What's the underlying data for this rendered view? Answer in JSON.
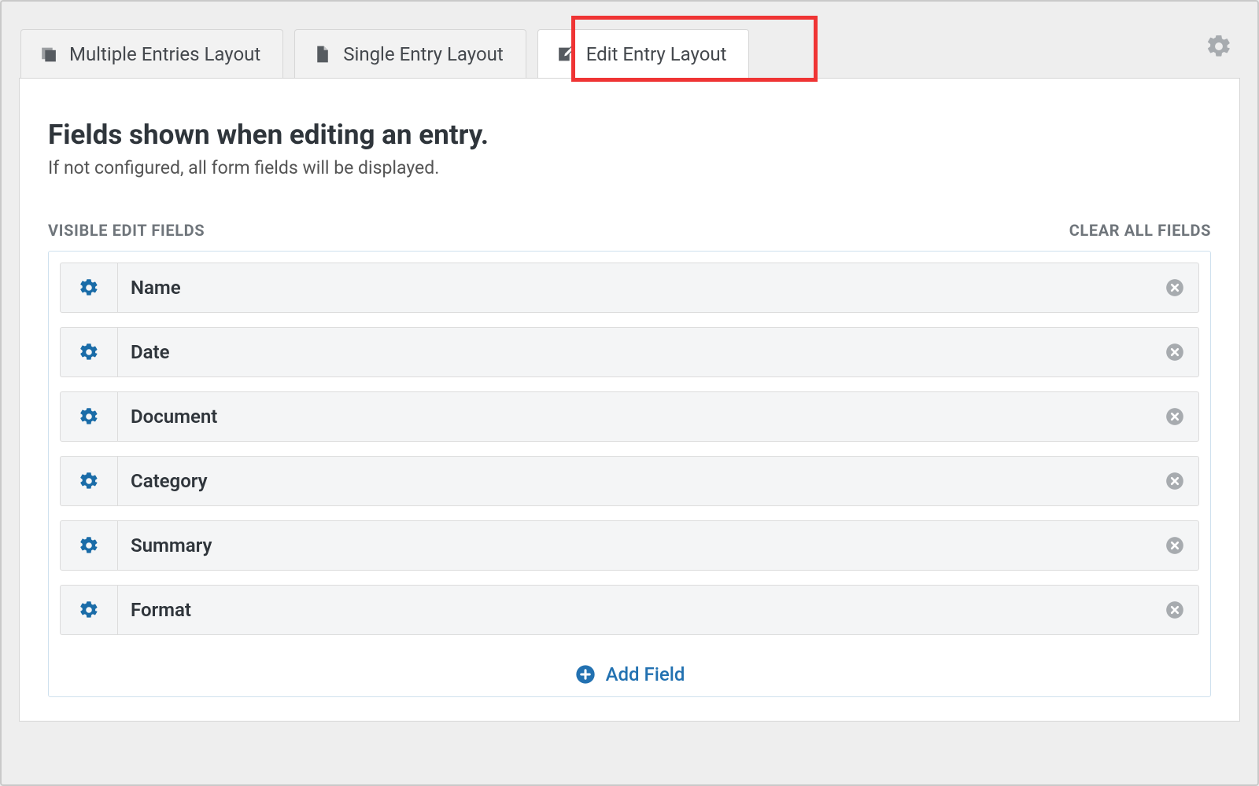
{
  "tabs": {
    "multiple": {
      "label": "Multiple Entries Layout"
    },
    "single": {
      "label": "Single Entry Layout"
    },
    "edit": {
      "label": "Edit Entry Layout"
    }
  },
  "heading": {
    "title": "Fields shown when editing an entry.",
    "subtitle": "If not configured, all form fields will be displayed."
  },
  "toolbar": {
    "visible_label": "Visible Edit Fields",
    "clear_label": "Clear All Fields"
  },
  "fields": [
    {
      "label": "Name"
    },
    {
      "label": "Date"
    },
    {
      "label": "Document"
    },
    {
      "label": "Category"
    },
    {
      "label": "Summary"
    },
    {
      "label": "Format"
    }
  ],
  "add_field": {
    "label": "Add Field"
  }
}
